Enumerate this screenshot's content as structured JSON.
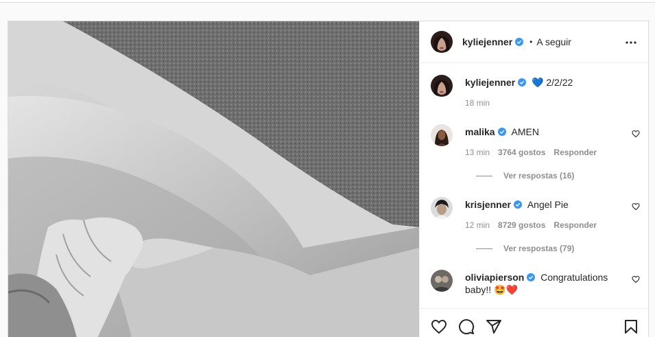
{
  "post": {
    "author": "kyliejenner",
    "follow_dot": "•",
    "follow_label": "A seguir",
    "more_icon": "more-horizontal-icon",
    "caption": {
      "user": "kyliejenner",
      "text": "💙 2/2/22",
      "time": "18 min"
    }
  },
  "comments": [
    {
      "user": "malika",
      "text": "AMEN",
      "time": "13 min",
      "likes": "3764 gostos",
      "reply_label": "Responder",
      "view_replies": "Ver respostas (16)"
    },
    {
      "user": "krisjenner",
      "text": "Angel Pie",
      "time": "12 min",
      "likes": "8729 gostos",
      "reply_label": "Responder",
      "view_replies": "Ver respostas (79)"
    },
    {
      "user": "oliviapierson",
      "text": "Congratulations baby!! 🤩❤️"
    }
  ],
  "actions": [
    "heart-icon",
    "comment-icon",
    "share-icon",
    "bookmark-icon"
  ],
  "colors": {
    "verified": "#3897f0",
    "muted": "#8e8e8e",
    "text": "#262626"
  }
}
